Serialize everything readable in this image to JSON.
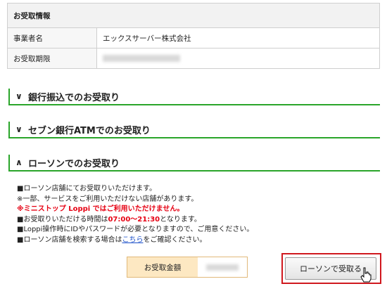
{
  "info": {
    "heading": "お受取情報",
    "rows": [
      {
        "label": "事業者名",
        "value": "エックスサーバー株式会社"
      },
      {
        "label": "お受取期限",
        "value": ""
      }
    ]
  },
  "sections": [
    {
      "label": "銀行振込でのお受取り",
      "chevron": "∨",
      "expanded": false
    },
    {
      "label": "セブン銀行ATMでのお受取り",
      "chevron": "∨",
      "expanded": false
    },
    {
      "label": "ローソンでのお受取り",
      "chevron": "∧",
      "expanded": true
    }
  ],
  "notes": {
    "line1": "■ローソン店舗にてお受取りいただけます。",
    "line2": "※一部、サービスをご利用いただけない店舗があります。",
    "line3": "※ミニストップ Loppi ではご利用いただけません。",
    "line4_pre": "■お受取りいただける時間は",
    "line4_time": "07:00〜21:30",
    "line4_post": "となります。",
    "line5": "■Loppi操作時にIDやパスワードが必要となりますので、ご用意ください。",
    "line6_pre": "■ローソン店舗を検索する場合は",
    "line6_link": "こちら",
    "line6_post": "をご確認ください。"
  },
  "amount": {
    "label": "お受取金額",
    "value": ""
  },
  "button": {
    "label": "ローソンで受取る"
  },
  "colors": {
    "accent_green": "#2aa52a",
    "warning_red": "#e60012",
    "highlight_red": "#d0181e",
    "amount_bg": "#fde8c2"
  }
}
